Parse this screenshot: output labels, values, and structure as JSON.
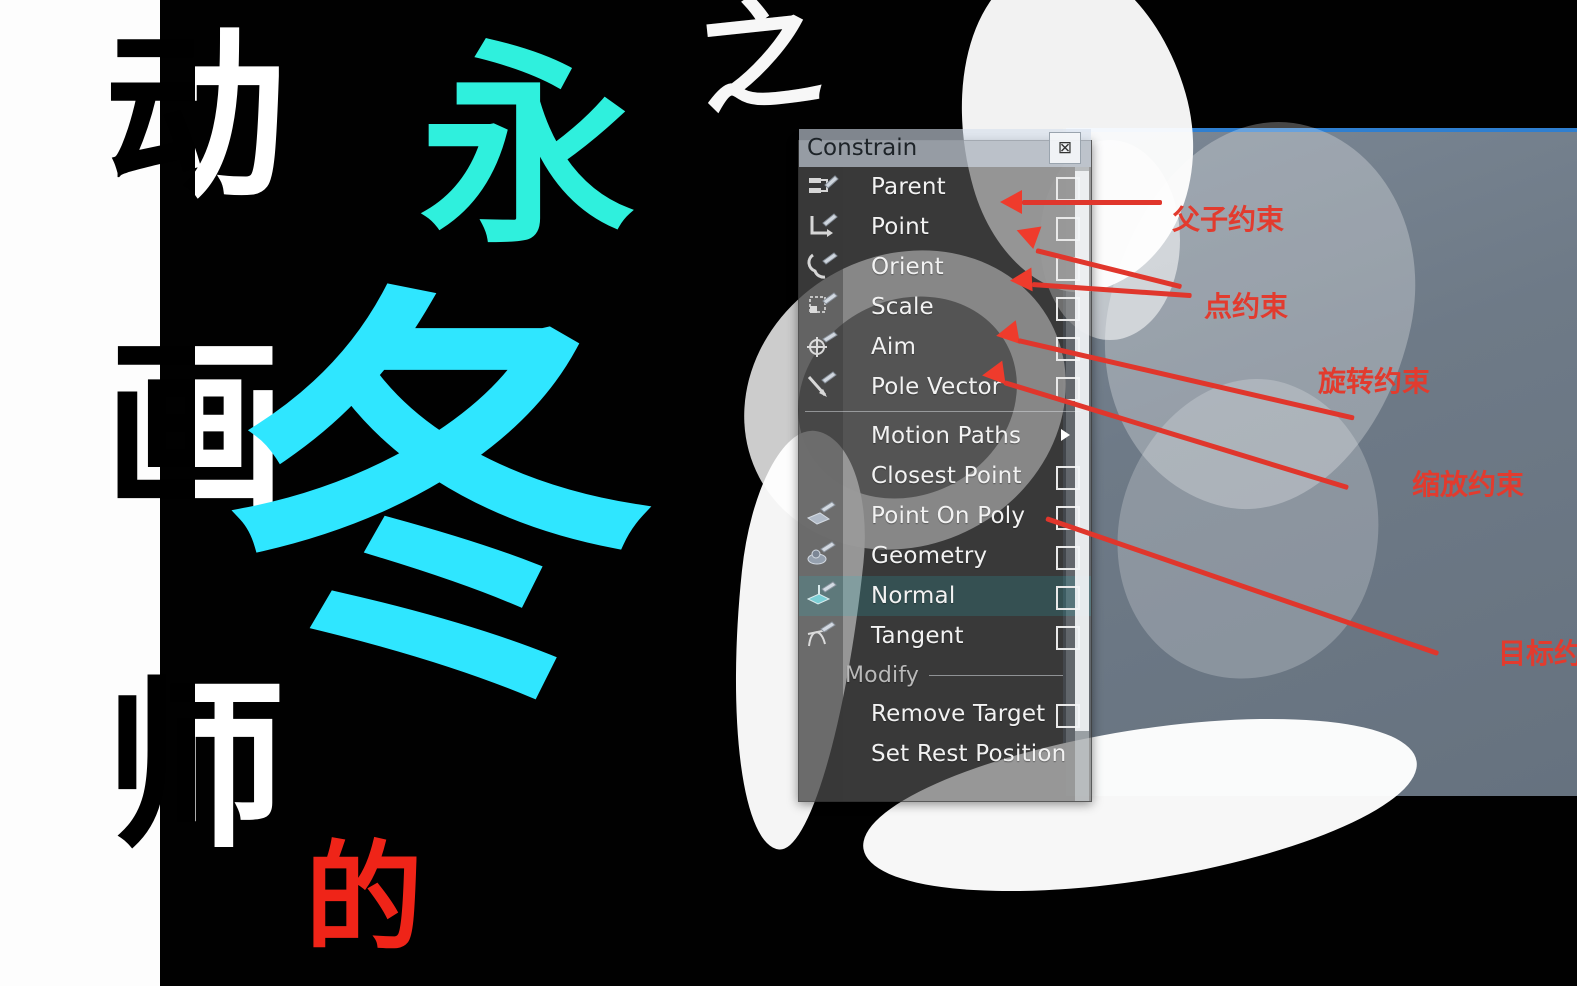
{
  "artwork": {
    "left_column_chars": [
      "动",
      "画",
      "师"
    ],
    "cyan_char_top": "永",
    "cyan_char_main": "冬",
    "white_char": "之",
    "red_char": "的"
  },
  "menu": {
    "title": "Constrain",
    "close_icon": "close-icon",
    "close_glyph": "⊠",
    "items": [
      {
        "label": "Parent",
        "icon": "parent-constraint-icon",
        "control": "checkbox",
        "highlighted": false
      },
      {
        "label": "Point",
        "icon": "point-constraint-icon",
        "control": "checkbox",
        "highlighted": false
      },
      {
        "label": "Orient",
        "icon": "orient-constraint-icon",
        "control": "checkbox",
        "highlighted": false
      },
      {
        "label": "Scale",
        "icon": "scale-constraint-icon",
        "control": "checkbox",
        "highlighted": false
      },
      {
        "label": "Aim",
        "icon": "aim-constraint-icon",
        "control": "checkbox",
        "highlighted": false
      },
      {
        "label": "Pole Vector",
        "icon": "pole-vector-constraint-icon",
        "control": "checkbox",
        "highlighted": false
      },
      {
        "label": "Motion Paths",
        "icon": "motion-paths-icon",
        "control": "submenu",
        "highlighted": false
      },
      {
        "label": "Closest Point",
        "icon": "closest-point-icon",
        "control": "checkbox",
        "highlighted": false
      },
      {
        "label": "Point On Poly",
        "icon": "point-on-poly-icon",
        "control": "checkbox",
        "highlighted": false
      },
      {
        "label": "Geometry",
        "icon": "geometry-constraint-icon",
        "control": "checkbox",
        "highlighted": false
      },
      {
        "label": "Normal",
        "icon": "normal-constraint-icon",
        "control": "checkbox",
        "highlighted": true
      },
      {
        "label": "Tangent",
        "icon": "tangent-constraint-icon",
        "control": "checkbox",
        "highlighted": false
      }
    ],
    "section_label": "Modify",
    "modify_items": [
      {
        "label": "Remove Target",
        "icon": "remove-target-icon",
        "control": "checkbox"
      },
      {
        "label": "Set Rest Position",
        "icon": "set-rest-position-icon",
        "control": "none"
      }
    ]
  },
  "annotations": [
    {
      "text": "父子约束",
      "target": "Parent"
    },
    {
      "text": "点约束",
      "target": "Point"
    },
    {
      "text": "旋转约束",
      "target": "Orient"
    },
    {
      "text": "缩放约束",
      "target": "Scale"
    },
    {
      "text": "目标约",
      "target": "Aim"
    }
  ],
  "colors": {
    "annotation_red": "#e23b2e",
    "cyan": "#2fe6ff",
    "panel_slate": "#6e7a87",
    "menu_grey": "#5c5c5c",
    "title_bar": "#d6e0ec"
  }
}
